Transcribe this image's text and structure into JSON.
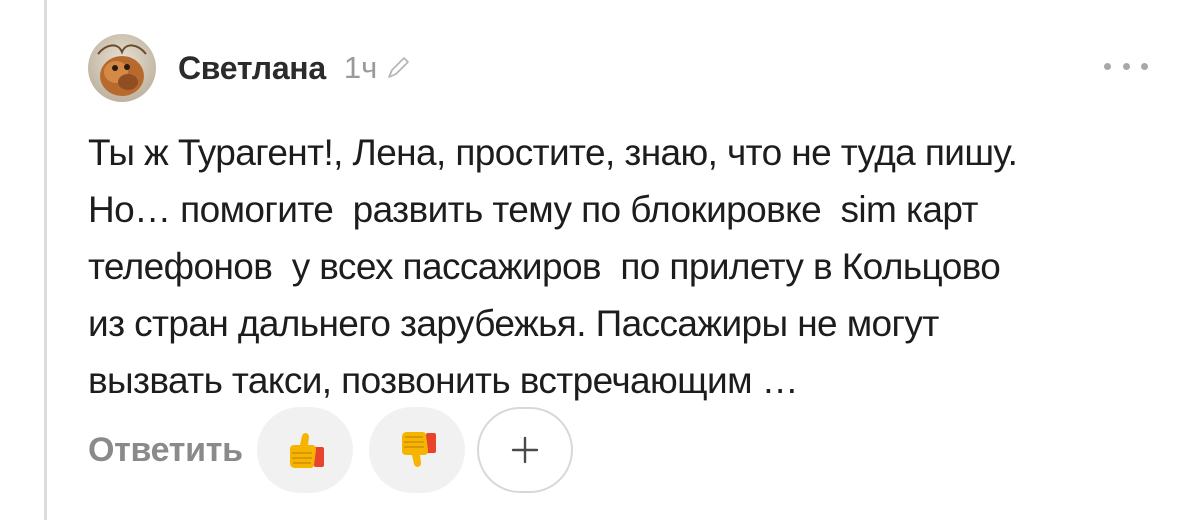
{
  "comment": {
    "author": "Светлана",
    "time": "1ч",
    "text": "Ты ж Турагент!, Лена, простите, знаю, что не туда пишу.\nНо… помогите  развить тему по блокировке  sim карт\nтелефонов  у всех пассажиров  по прилету в Кольцово\nиз стран дальнего зарубежья. Пассажиры не могут\nвызвать такси, позвонить встречающим …"
  },
  "actions": {
    "reply_label": "Ответить"
  },
  "icons": {
    "avatar": "avatar-photo",
    "edit": "pencil-icon",
    "more": "more-dots-icon",
    "like": "thumbs-up-icon",
    "dislike": "thumbs-down-icon",
    "add": "plus-icon"
  },
  "colors": {
    "text": "#1d1d1d",
    "muted": "#9a9a9a",
    "reaction_bg": "#f1f1f1",
    "thumb_yellow": "#f5b400",
    "thumb_red": "#e8432b"
  }
}
